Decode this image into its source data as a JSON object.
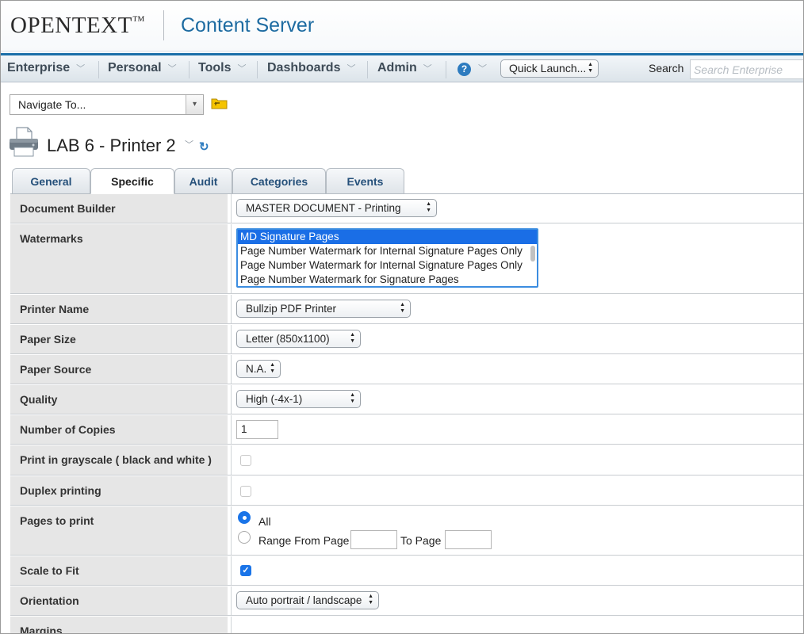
{
  "header": {
    "brand": "OPENTEXT",
    "brand_tm": "™",
    "product": "Content Server"
  },
  "nav": {
    "items": [
      {
        "label": "Enterprise"
      },
      {
        "label": "Personal"
      },
      {
        "label": "Tools"
      },
      {
        "label": "Dashboards"
      },
      {
        "label": "Admin"
      }
    ],
    "chevron": "﹀",
    "help_glyph": "?",
    "quick_launch": "Quick Launch...",
    "search_label": "Search",
    "search_placeholder": "Search Enterprise"
  },
  "navigate": {
    "label": "Navigate To...",
    "drop_glyph": "▾"
  },
  "item": {
    "title": "LAB 6 - Printer 2",
    "chevron": "﹀",
    "refresh_glyph": "↻"
  },
  "tabs": [
    {
      "label": "General",
      "active": false
    },
    {
      "label": "Specific",
      "active": true
    },
    {
      "label": "Audit",
      "active": false
    },
    {
      "label": "Categories",
      "active": false
    },
    {
      "label": "Events",
      "active": false
    }
  ],
  "fields": {
    "document_builder": {
      "label": "Document Builder",
      "value": "MASTER DOCUMENT - Printing"
    },
    "watermarks": {
      "label": "Watermarks",
      "options": [
        {
          "text": "MD Signature Pages",
          "selected": true
        },
        {
          "text": "Page Number Watermark for Internal Signature Pages Only",
          "selected": false
        },
        {
          "text": "Page Number Watermark for Internal Signature Pages Only",
          "selected": false
        },
        {
          "text": "Page Number Watermark for Signature Pages",
          "selected": false
        }
      ]
    },
    "printer_name": {
      "label": "Printer Name",
      "value": "Bullzip PDF Printer"
    },
    "paper_size": {
      "label": "Paper Size",
      "value": "Letter (850x1100)"
    },
    "paper_source": {
      "label": "Paper Source",
      "value": "N.A."
    },
    "quality": {
      "label": "Quality",
      "value": "High (-4x-1)"
    },
    "copies": {
      "label": "Number of Copies",
      "value": "1"
    },
    "grayscale": {
      "label": "Print in grayscale ( black and white )",
      "checked": false
    },
    "duplex": {
      "label": "Duplex printing",
      "checked": false
    },
    "pages": {
      "label": "Pages to print",
      "all_label": "All",
      "range_label": "Range From Page",
      "to_label": "To Page",
      "selected": "All",
      "from_value": "",
      "to_value": ""
    },
    "scale": {
      "label": "Scale to Fit",
      "checked": true,
      "check_glyph": "✓"
    },
    "orientation": {
      "label": "Orientation",
      "value": "Auto portrait / landscape"
    },
    "margins": {
      "label": "Margins"
    }
  },
  "colors": {
    "accent": "#1a6fa8",
    "product": "#1d6ba1",
    "tab_text": "#25507a",
    "label_bg": "#e6e6e6",
    "selection": "#1a6ee6"
  }
}
